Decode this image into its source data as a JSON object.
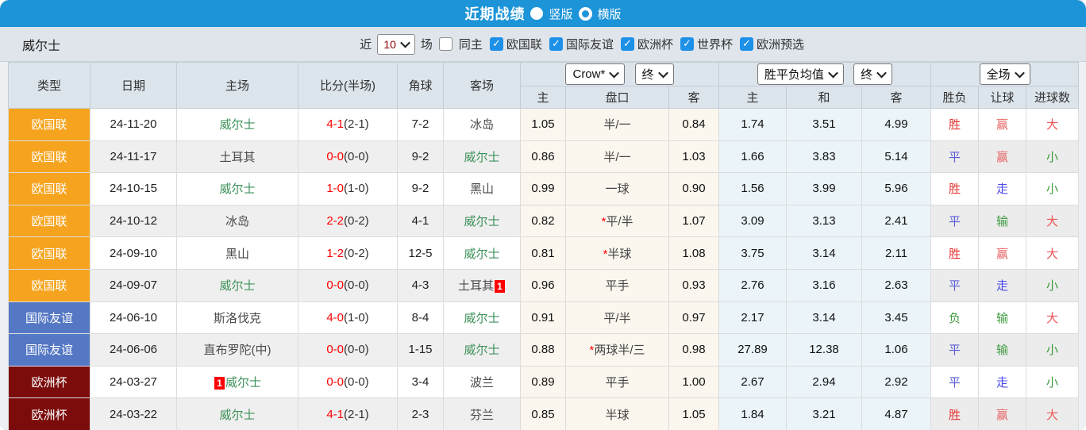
{
  "titlebar": {
    "title": "近期战绩",
    "radio_vertical": "竖版",
    "radio_horizontal": "横版",
    "selected": "竖版"
  },
  "filter": {
    "team": "威尔士",
    "recent_label": "近",
    "count_value": "10",
    "matches_label": "场",
    "same_venue_label": "同主",
    "same_venue_checked": false,
    "leagues": [
      "欧国联",
      "国际友谊",
      "欧洲杯",
      "世界杯",
      "欧洲预选"
    ],
    "leagues_checked": [
      true,
      true,
      true,
      true,
      true
    ]
  },
  "table": {
    "static_headers": [
      "类型",
      "日期",
      "主场",
      "比分(半场)",
      "角球",
      "客场"
    ],
    "odds_group": {
      "select1": "Crow*",
      "select2": "终",
      "cols": [
        "主",
        "盘口",
        "客"
      ]
    },
    "avg_group": {
      "select1": "胜平负均值",
      "select2": "终",
      "cols": [
        "主",
        "和",
        "客"
      ]
    },
    "result_group": {
      "select": "全场",
      "cols": [
        "胜负",
        "让球",
        "进球数"
      ]
    },
    "rows": [
      {
        "league": "欧国联",
        "date": "24-11-20",
        "home": "威尔士",
        "home_badge": "",
        "score": "4-1",
        "half": "(2-1)",
        "corner": "7-2",
        "away": "冰岛",
        "away_badge": "",
        "o_home": "1.05",
        "star": false,
        "handicap": "半/一",
        "o_away": "0.84",
        "avg_home": "1.74",
        "avg_draw": "3.51",
        "avg_away": "4.99",
        "wdl": "胜",
        "let_result": "赢",
        "goals": "大"
      },
      {
        "league": "欧国联",
        "date": "24-11-17",
        "home": "土耳其",
        "home_badge": "",
        "score": "0-0",
        "half": "(0-0)",
        "corner": "9-2",
        "away": "威尔士",
        "away_badge": "",
        "o_home": "0.86",
        "star": false,
        "handicap": "半/一",
        "o_away": "1.03",
        "avg_home": "1.66",
        "avg_draw": "3.83",
        "avg_away": "5.14",
        "wdl": "平",
        "let_result": "赢",
        "goals": "小"
      },
      {
        "league": "欧国联",
        "date": "24-10-15",
        "home": "威尔士",
        "home_badge": "",
        "score": "1-0",
        "half": "(1-0)",
        "corner": "9-2",
        "away": "黑山",
        "away_badge": "",
        "o_home": "0.99",
        "star": false,
        "handicap": "一球",
        "o_away": "0.90",
        "avg_home": "1.56",
        "avg_draw": "3.99",
        "avg_away": "5.96",
        "wdl": "胜",
        "let_result": "走",
        "goals": "小"
      },
      {
        "league": "欧国联",
        "date": "24-10-12",
        "home": "冰岛",
        "home_badge": "",
        "score": "2-2",
        "half": "(0-2)",
        "corner": "4-1",
        "away": "威尔士",
        "away_badge": "",
        "o_home": "0.82",
        "star": true,
        "handicap": "平/半",
        "o_away": "1.07",
        "avg_home": "3.09",
        "avg_draw": "3.13",
        "avg_away": "2.41",
        "wdl": "平",
        "let_result": "输",
        "goals": "大"
      },
      {
        "league": "欧国联",
        "date": "24-09-10",
        "home": "黑山",
        "home_badge": "",
        "score": "1-2",
        "half": "(0-2)",
        "corner": "12-5",
        "away": "威尔士",
        "away_badge": "",
        "o_home": "0.81",
        "star": true,
        "handicap": "半球",
        "o_away": "1.08",
        "avg_home": "3.75",
        "avg_draw": "3.14",
        "avg_away": "2.11",
        "wdl": "胜",
        "let_result": "赢",
        "goals": "大"
      },
      {
        "league": "欧国联",
        "date": "24-09-07",
        "home": "威尔士",
        "home_badge": "",
        "score": "0-0",
        "half": "(0-0)",
        "corner": "4-3",
        "away": "土耳其",
        "away_badge": "1",
        "o_home": "0.96",
        "star": false,
        "handicap": "平手",
        "o_away": "0.93",
        "avg_home": "2.76",
        "avg_draw": "3.16",
        "avg_away": "2.63",
        "wdl": "平",
        "let_result": "走",
        "goals": "小"
      },
      {
        "league": "国际友谊",
        "date": "24-06-10",
        "home": "斯洛伐克",
        "home_badge": "",
        "score": "4-0",
        "half": "(1-0)",
        "corner": "8-4",
        "away": "威尔士",
        "away_badge": "",
        "o_home": "0.91",
        "star": false,
        "handicap": "平/半",
        "o_away": "0.97",
        "avg_home": "2.17",
        "avg_draw": "3.14",
        "avg_away": "3.45",
        "wdl": "负",
        "let_result": "输",
        "goals": "大"
      },
      {
        "league": "国际友谊",
        "date": "24-06-06",
        "home": "直布罗陀(中)",
        "home_badge": "",
        "score": "0-0",
        "half": "(0-0)",
        "corner": "1-15",
        "away": "威尔士",
        "away_badge": "",
        "o_home": "0.88",
        "star": true,
        "handicap": "两球半/三",
        "o_away": "0.98",
        "avg_home": "27.89",
        "avg_draw": "12.38",
        "avg_away": "1.06",
        "wdl": "平",
        "let_result": "输",
        "goals": "小"
      },
      {
        "league": "欧洲杯",
        "date": "24-03-27",
        "home": "威尔士",
        "home_badge": "1",
        "score": "0-0",
        "half": "(0-0)",
        "corner": "3-4",
        "away": "波兰",
        "away_badge": "",
        "o_home": "0.89",
        "star": false,
        "handicap": "平手",
        "o_away": "1.00",
        "avg_home": "2.67",
        "avg_draw": "2.94",
        "avg_away": "2.92",
        "wdl": "平",
        "let_result": "走",
        "goals": "小"
      },
      {
        "league": "欧洲杯",
        "date": "24-03-22",
        "home": "威尔士",
        "home_badge": "",
        "score": "4-1",
        "half": "(2-1)",
        "corner": "2-3",
        "away": "芬兰",
        "away_badge": "",
        "o_home": "0.85",
        "star": false,
        "handicap": "半球",
        "o_away": "1.05",
        "avg_home": "1.84",
        "avg_draw": "3.21",
        "avg_away": "4.87",
        "wdl": "胜",
        "let_result": "赢",
        "goals": "大"
      }
    ]
  },
  "colors": {
    "accent_bar": "#1d94d8",
    "league": {
      "欧国联": "#f6a41f",
      "国际友谊": "#5578c4",
      "欧洲杯": "#7c0c0c"
    },
    "result": {
      "胜": "#e83333",
      "平": "#5b5bd6",
      "负": "#3f9a3f",
      "赢": "#e86666",
      "输": "#3f9a3f",
      "走": "#4a4af0",
      "大": "#ee5555",
      "小": "#3f9a3f"
    },
    "wales_team": "#3c9159",
    "score": "#ff0000"
  }
}
